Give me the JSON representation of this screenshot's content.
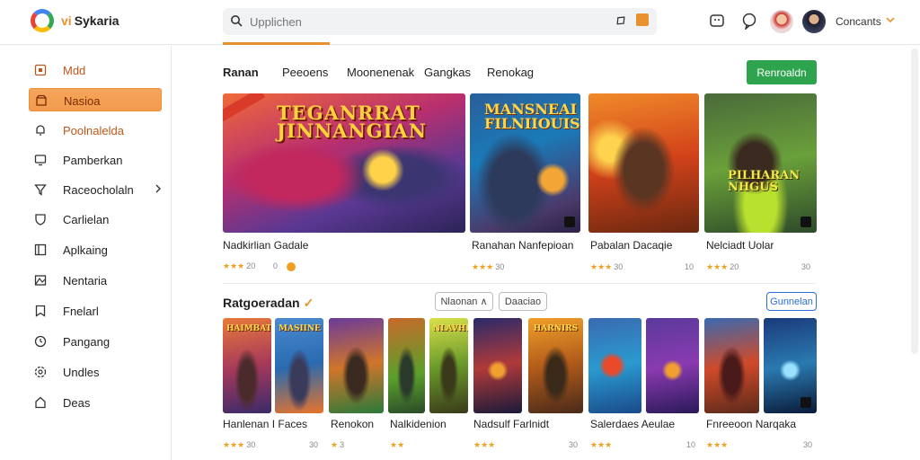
{
  "header": {
    "app_name": "Sykaria",
    "search_placeholder": "Upplichen",
    "user_name": "Concants"
  },
  "sidebar": {
    "items": [
      {
        "label": "Mdd",
        "icon": "home-icon"
      },
      {
        "label": "Nasioa",
        "icon": "store-icon"
      },
      {
        "label": "Poolnalelda",
        "icon": "bell-icon"
      },
      {
        "label": "Pamberkan",
        "icon": "monitor-icon"
      },
      {
        "label": "Raceocholaln",
        "icon": "filter-icon"
      },
      {
        "label": "Carlielan",
        "icon": "shield-icon"
      },
      {
        "label": "Aplkaing",
        "icon": "apps-icon"
      },
      {
        "label": "Nentaria",
        "icon": "mountain-icon"
      },
      {
        "label": "Fnelarl",
        "icon": "bookmark-icon"
      },
      {
        "label": "Pangang",
        "icon": "clock-icon"
      },
      {
        "label": "Undles",
        "icon": "settings-icon"
      },
      {
        "label": "Deas",
        "icon": "help-icon"
      }
    ]
  },
  "tabs": [
    "Ranan",
    "Peeoens",
    "Moonenenak",
    "Gangkas",
    "Renokag"
  ],
  "action_button": "Renroaldn",
  "featured": {
    "hero_banner": "TEGANRRAT\nJINNANGIAN",
    "card2_banner": "MANSNEAI\nFILNIIOUIS",
    "card4_banner": "PILHARAN\nNHGUS",
    "items": [
      {
        "title": "Nadkirlian Gadale",
        "stars": "★★★",
        "rating": "20",
        "meta": "0"
      },
      {
        "title": "Ranahan Nanfepioan",
        "stars": "★★★",
        "rating": "30",
        "meta": ""
      },
      {
        "title": "Pabalan Dacaqie",
        "stars": "★★★",
        "rating": "30",
        "meta": "10"
      },
      {
        "title": "Nelciadt Uolar",
        "stars": "★★★",
        "rating": "20",
        "meta": "30"
      }
    ]
  },
  "section2": {
    "title": "Ratgoeradan",
    "filter1": "Nlaonan ∧",
    "filter2": "Daaciao",
    "filter3": "Gunnelan",
    "items": [
      {
        "title": "Hanlenan I Faces",
        "stars": "★★★",
        "rating": "30",
        "meta": "30"
      },
      {
        "title": "Renokon",
        "stars": "★",
        "rating": "3",
        "meta": ""
      },
      {
        "title": "Nalkidenion",
        "stars": "★★",
        "rating": "",
        "meta": ""
      },
      {
        "title": "Nadsulf Farlnidt",
        "stars": "★★★",
        "rating": "",
        "meta": "30"
      },
      {
        "title": "Salerdaes Aeulae",
        "stars": "★★★",
        "rating": "",
        "meta": "10"
      },
      {
        "title": "Fnreeoon Narqaka",
        "stars": "★★★",
        "rating": "",
        "meta": "30"
      }
    ],
    "thumb_banners": [
      "HAIMBAT",
      "MASIINE",
      "NLAVHE",
      "HARNIRS"
    ]
  }
}
